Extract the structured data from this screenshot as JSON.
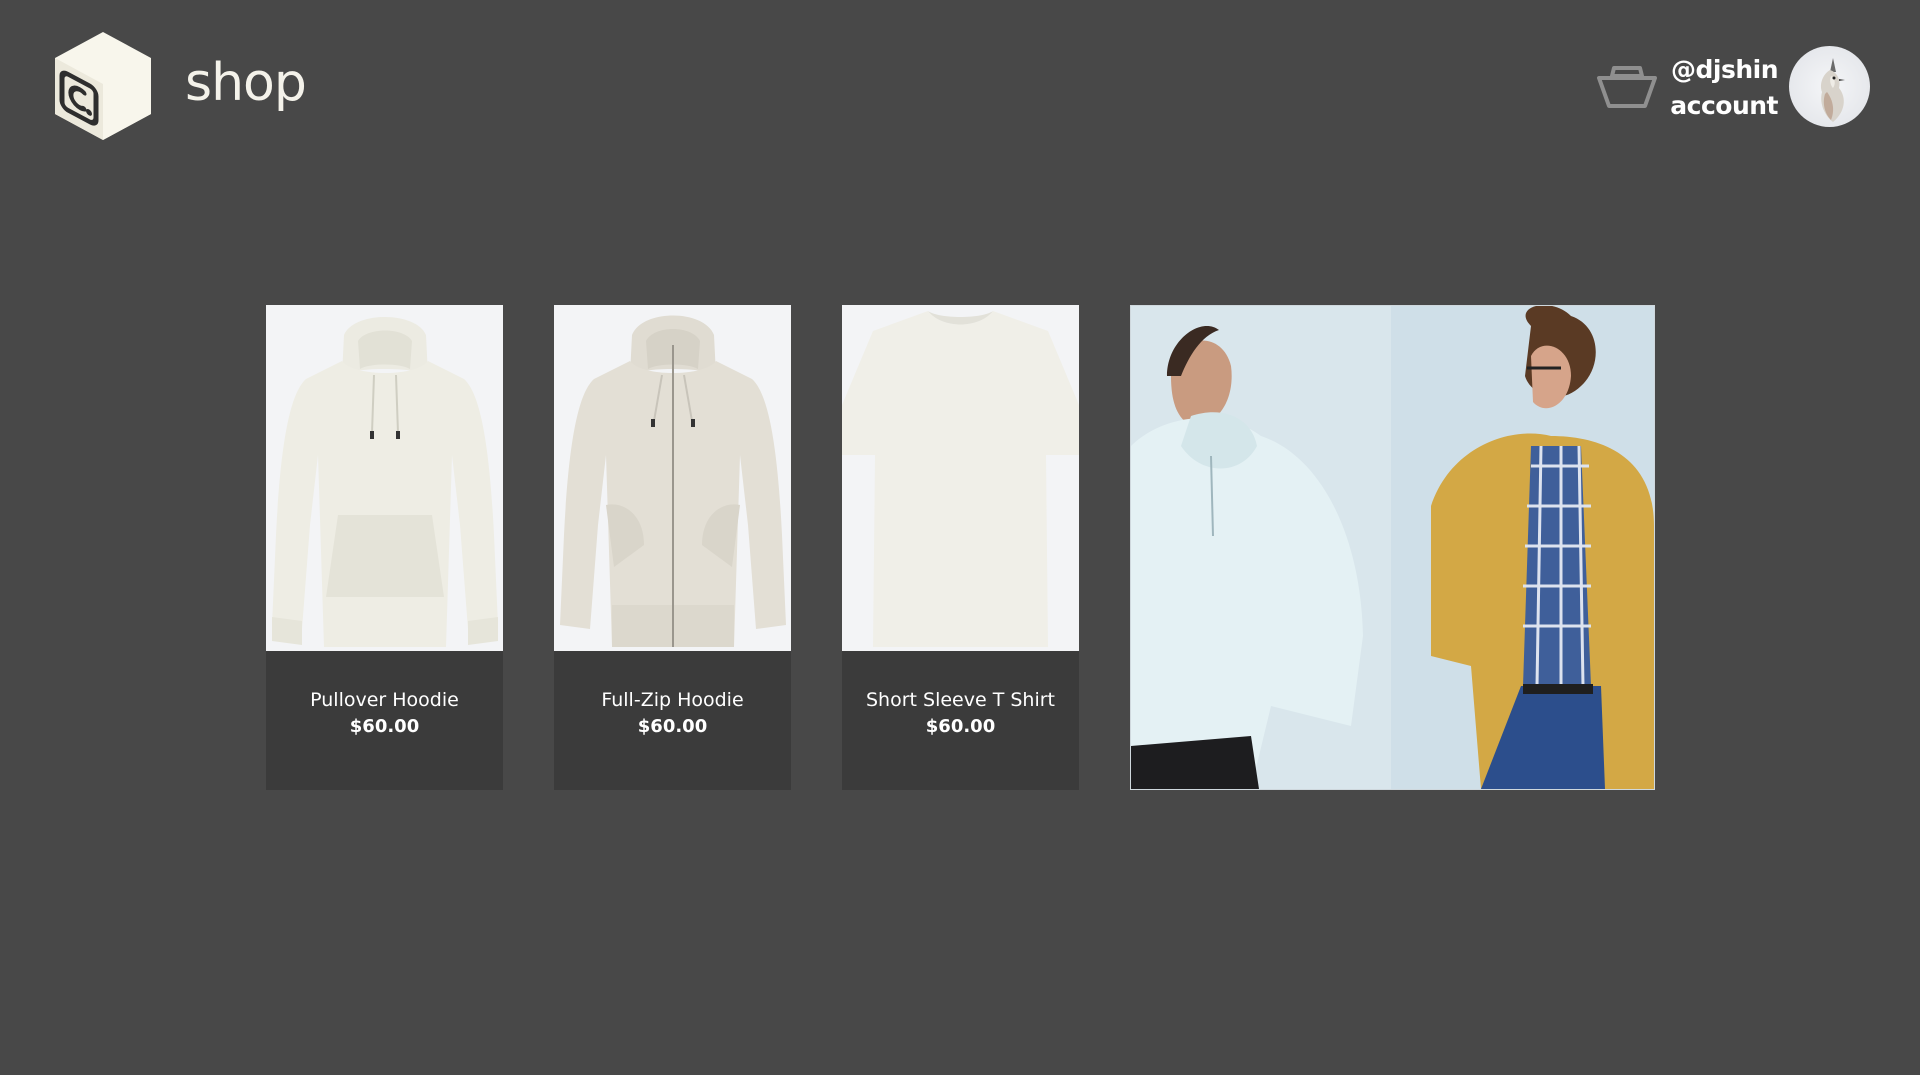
{
  "header": {
    "title": "shop",
    "logo_icon": "cube-logo-icon",
    "cart_icon": "shopping-basket-icon",
    "user_handle": "@djshin",
    "account_label": "account"
  },
  "products": [
    {
      "name": "Pullover Hoodie",
      "price": "$60.00",
      "image": "white-pullover-hoodie"
    },
    {
      "name": "Full-Zip Hoodie",
      "price": "$60.00",
      "image": "oatmeal-full-zip-hoodie"
    },
    {
      "name": "Short Sleeve T Shirt",
      "price": "$60.00",
      "image": "white-short-sleeve-tshirt"
    }
  ],
  "feature_image": "two-men-wearing-hoodies",
  "colors": {
    "background": "#484848",
    "card_footer": "#3b3b3b",
    "text": "#ffffff",
    "logo": "#f8f6ec"
  }
}
